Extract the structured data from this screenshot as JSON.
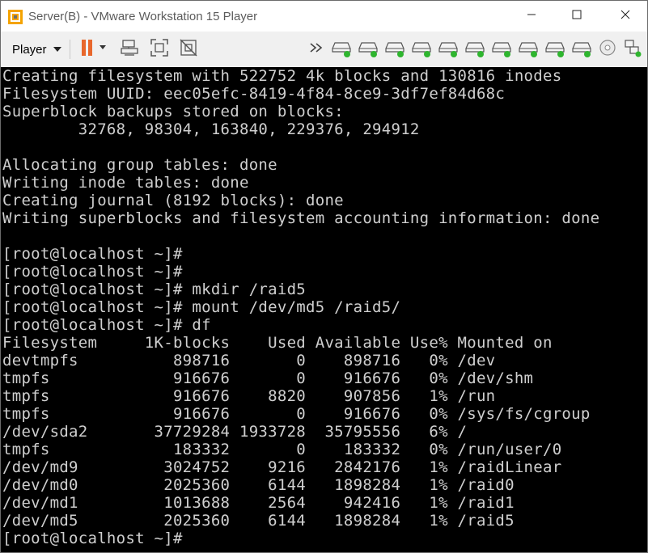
{
  "window": {
    "title": "Server(B) - VMware Workstation 15 Player"
  },
  "toolbar": {
    "player_label": "Player"
  },
  "terminal": {
    "lines": [
      "Creating filesystem with 522752 4k blocks and 130816 inodes",
      "Filesystem UUID: eec05efc-8419-4f84-8ce9-3df7ef84d68c",
      "Superblock backups stored on blocks:",
      "        32768, 98304, 163840, 229376, 294912",
      "",
      "Allocating group tables: done",
      "Writing inode tables: done",
      "Creating journal (8192 blocks): done",
      "Writing superblocks and filesystem accounting information: done",
      "",
      "[root@localhost ~]#",
      "[root@localhost ~]#",
      "[root@localhost ~]# mkdir /raid5",
      "[root@localhost ~]# mount /dev/md5 /raid5/",
      "[root@localhost ~]# df",
      "Filesystem     1K-blocks    Used Available Use% Mounted on",
      "devtmpfs          898716       0    898716   0% /dev",
      "tmpfs             916676       0    916676   0% /dev/shm",
      "tmpfs             916676    8820    907856   1% /run",
      "tmpfs             916676       0    916676   0% /sys/fs/cgroup",
      "/dev/sda2       37729284 1933728  35795556   6% /",
      "tmpfs             183332       0    183332   0% /run/user/0",
      "/dev/md9         3024752    9216   2842176   1% /raidLinear",
      "/dev/md0         2025360    6144   1898284   1% /raid0",
      "/dev/md1         1013688    2564    942416   1% /raid1",
      "/dev/md5         2025360    6144   1898284   1% /raid5",
      "[root@localhost ~]#"
    ]
  }
}
